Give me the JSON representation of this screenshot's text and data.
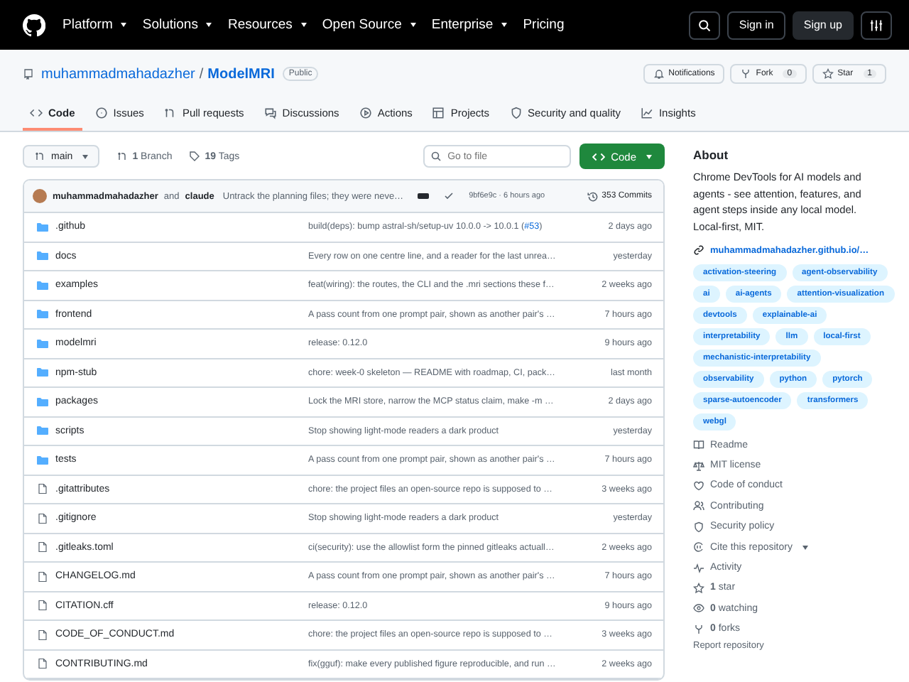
{
  "topnav": {
    "items": [
      {
        "label": "Platform",
        "caret": true
      },
      {
        "label": "Solutions",
        "caret": true
      },
      {
        "label": "Resources",
        "caret": true
      },
      {
        "label": "Open Source",
        "caret": true
      },
      {
        "label": "Enterprise",
        "caret": true
      },
      {
        "label": "Pricing",
        "caret": false
      }
    ],
    "sign_in": "Sign in",
    "sign_up": "Sign up"
  },
  "repo": {
    "owner": "muhammadmahadazher",
    "separator": "/",
    "name": "ModelMRI",
    "visibility": "Public",
    "notifications": "Notifications",
    "fork": "Fork",
    "fork_count": "0",
    "star": "Star",
    "star_count": "1"
  },
  "tabs": [
    {
      "label": "Code",
      "selected": true
    },
    {
      "label": "Issues",
      "selected": false
    },
    {
      "label": "Pull requests",
      "selected": false
    },
    {
      "label": "Discussions",
      "selected": false
    },
    {
      "label": "Actions",
      "selected": false
    },
    {
      "label": "Projects",
      "selected": false
    },
    {
      "label": "Security and quality",
      "selected": false
    },
    {
      "label": "Insights",
      "selected": false
    }
  ],
  "toolbar": {
    "branch": "main",
    "branches": "**1** Branch",
    "tags": "**19** Tags",
    "search_placeholder": "Go to file",
    "code_button": "Code"
  },
  "commit": {
    "author": "muhammadmahadazher",
    "conjunction": "and",
    "coauthor": "claude",
    "message": "Untrack the planning files; they were neve…",
    "hash_time": "9bf6e9c · 6 hours ago",
    "commits": "353 Commits"
  },
  "files": [
    {
      "kind": "folder",
      "name": ".github",
      "message": "build(deps): bump astral-sh/setup-uv 10.0.0 -> 10.0.1 (",
      "link": "#53",
      "message_end": ")",
      "time": "2 days ago"
    },
    {
      "kind": "folder",
      "name": "docs",
      "message": "Every row on one centre line, and a reader for the last unrea…",
      "time": "yesterday"
    },
    {
      "kind": "folder",
      "name": "examples",
      "message": "feat(wiring): the routes, the CLI and the .mri sections these f…",
      "time": "2 weeks ago"
    },
    {
      "kind": "folder",
      "name": "frontend",
      "message": "A pass count from one prompt pair, shown as another pair's …",
      "time": "7 hours ago"
    },
    {
      "kind": "folder",
      "name": "modelmri",
      "message": "release: 0.12.0",
      "time": "9 hours ago"
    },
    {
      "kind": "folder",
      "name": "npm-stub",
      "message": "chore: week-0 skeleton — README with roadmap, CI, pack…",
      "time": "last month"
    },
    {
      "kind": "folder",
      "name": "packages",
      "message": "Lock the MRI store, narrow the MCP status claim, make -m …",
      "time": "2 days ago"
    },
    {
      "kind": "folder",
      "name": "scripts",
      "message": "Stop showing light-mode readers a dark product",
      "time": "yesterday"
    },
    {
      "kind": "folder",
      "name": "tests",
      "message": "A pass count from one prompt pair, shown as another pair's …",
      "time": "7 hours ago"
    },
    {
      "kind": "file",
      "name": ".gitattributes",
      "message": "chore: the project files an open-source repo is supposed to …",
      "time": "3 weeks ago"
    },
    {
      "kind": "file",
      "name": ".gitignore",
      "message": "Stop showing light-mode readers a dark product",
      "time": "yesterday"
    },
    {
      "kind": "file",
      "name": ".gitleaks.toml",
      "message": "ci(security): use the allowlist form the pinned gitleaks actuall…",
      "time": "2 weeks ago"
    },
    {
      "kind": "file",
      "name": "CHANGELOG.md",
      "message": "A pass count from one prompt pair, shown as another pair's …",
      "time": "7 hours ago"
    },
    {
      "kind": "file",
      "name": "CITATION.cff",
      "message": "release: 0.12.0",
      "time": "9 hours ago"
    },
    {
      "kind": "file",
      "name": "CODE_OF_CONDUCT.md",
      "message": "chore: the project files an open-source repo is supposed to …",
      "time": "3 weeks ago"
    },
    {
      "kind": "file",
      "name": "CONTRIBUTING.md",
      "message": "fix(gguf): make every published figure reproducible, and run …",
      "time": "2 weeks ago"
    }
  ],
  "about": {
    "title": "About",
    "description": "Chrome DevTools for AI models and agents - see attention, features, and agent steps inside any local model. Local-first, MIT.",
    "website": "muhammadmahadazher.github.io/…",
    "topics": [
      "activation-steering",
      "agent-observability",
      "ai",
      "ai-agents",
      "attention-visualization",
      "devtools",
      "explainable-ai",
      "interpretability",
      "llm",
      "local-first",
      "mechanistic-interpretability",
      "observability",
      "python",
      "pytorch",
      "sparse-autoencoder",
      "transformers",
      "webgl"
    ],
    "links": [
      {
        "label": "Readme",
        "caret": false
      },
      {
        "label": "MIT license",
        "caret": false
      },
      {
        "label": "Code of conduct",
        "caret": false
      },
      {
        "label": "Contributing",
        "caret": false
      },
      {
        "label": "Security policy",
        "caret": false
      },
      {
        "label": "Cite this repository",
        "caret": true
      },
      {
        "label": "Activity",
        "caret": false
      },
      {
        "label": "**1** star",
        "caret": false
      },
      {
        "label": "**0** watching",
        "caret": false
      },
      {
        "label": "**0** forks",
        "caret": false
      }
    ],
    "report": "Report repository"
  }
}
